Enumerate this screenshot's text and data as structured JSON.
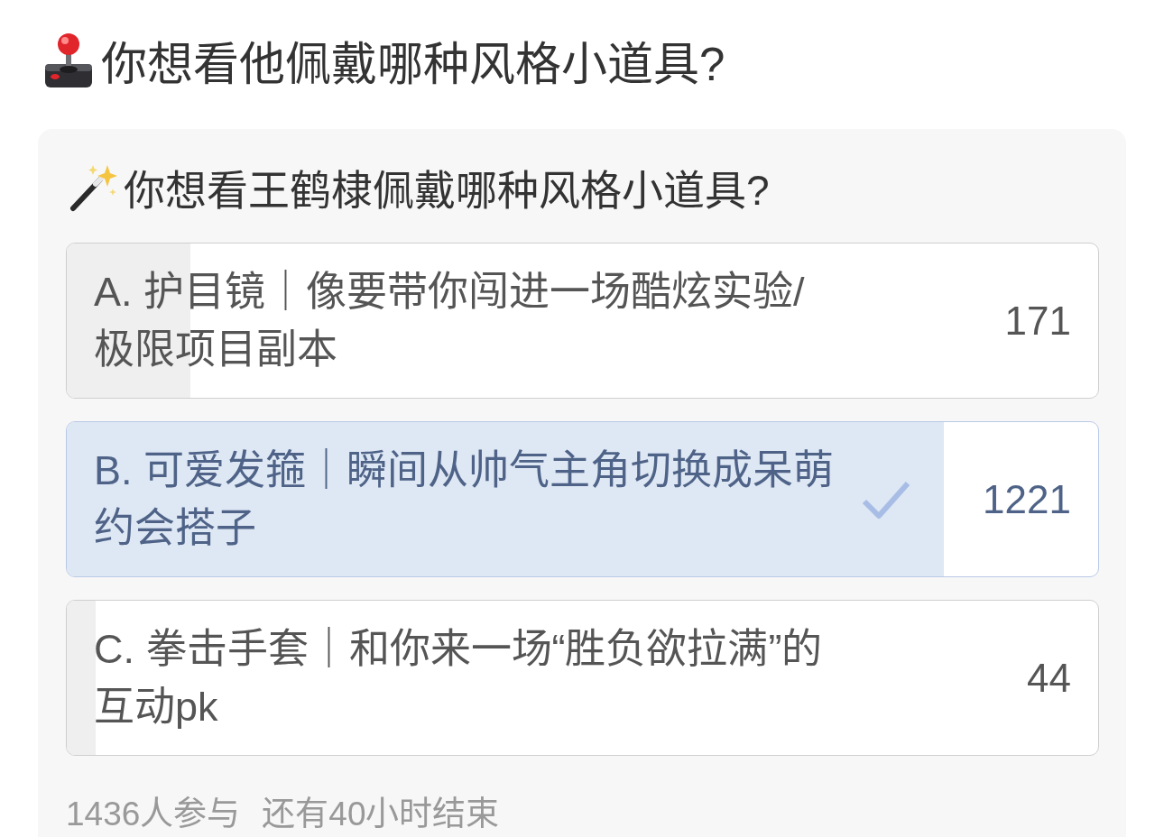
{
  "header": {
    "title": "你想看他佩戴哪种风格小道具?"
  },
  "poll": {
    "title": "你想看王鹤棣佩戴哪种风格小道具?",
    "options": [
      {
        "label": "A. 护目镜｜像要带你闯进一场酷炫实验/极限项目副本",
        "count": "171",
        "level": 0.12,
        "selected": false
      },
      {
        "label": "B. 可爱发箍｜瞬间从帅气主角切换成呆萌约会搭子",
        "count": "1221",
        "level": 0.85,
        "selected": true
      },
      {
        "label": "C. 拳击手套｜和你来一场“胜负欲拉满”的互动pk",
        "count": "44",
        "level": 0.028,
        "selected": false
      }
    ],
    "participants": "1436人参与",
    "time_left": "还有40小时结束"
  }
}
